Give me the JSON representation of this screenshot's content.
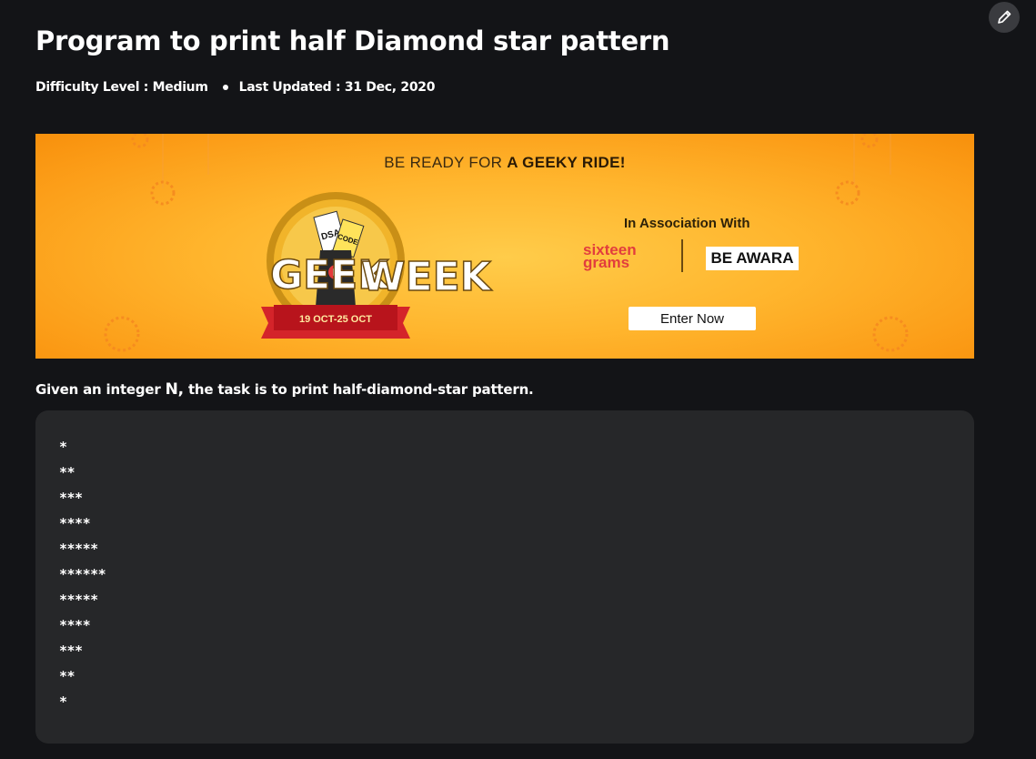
{
  "article": {
    "title": "Program to print half Diamond star pattern",
    "difficulty": "Difficulty Level : Medium",
    "updated": "Last Updated : 31 Dec, 2020"
  },
  "banner": {
    "headline_prefix": "BE READY FOR ",
    "headline_bold": "A GEEKY RIDE!",
    "event_name_left": "GEEK",
    "event_name_right": "WEEK",
    "event_dates": "19 OCT-25 OCT",
    "ticket_labels": [
      "DSA",
      "CODE"
    ],
    "association": "In Association With",
    "partner_1_line_1": "sixteen",
    "partner_1_line_2": "grams",
    "partner_2": "BE AWARA",
    "cta": "Enter Now",
    "colors": {
      "background": "#ffb52d",
      "partner_1": "#e23d3d",
      "ribbon": "#d4242a"
    }
  },
  "body": {
    "intro_prefix": "Given an integer ",
    "intro_var": "N,",
    "intro_suffix": " the task is to print half-diamond-star pattern."
  },
  "code_block": {
    "lines": [
      "*",
      "**",
      "***",
      "****",
      "*****",
      "******",
      "*****",
      "****",
      "***",
      "**",
      "*"
    ]
  },
  "toolbar": {
    "edit_icon": "pencil-icon"
  }
}
